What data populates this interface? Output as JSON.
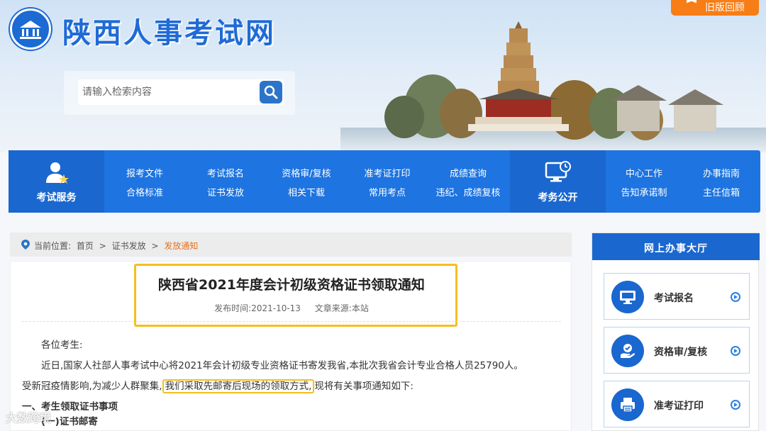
{
  "header": {
    "site_title": "陕西人事考试网",
    "old_version_label": "旧版回顾",
    "search": {
      "placeholder": "请输入检索内容"
    }
  },
  "nav": {
    "main_left": "考试服务",
    "main_right": "考务公开",
    "columns": [
      {
        "top": "报考文件",
        "bottom": "合格标准"
      },
      {
        "top": "考试报名",
        "bottom": "证书发放"
      },
      {
        "top": "资格审/复核",
        "bottom": "相关下载"
      },
      {
        "top": "准考证打印",
        "bottom": "常用考点"
      },
      {
        "top": "成绩查询",
        "bottom": "违纪、成绩复核"
      },
      {
        "top": "中心工作",
        "bottom": "告知承诺制"
      },
      {
        "top": "办事指南",
        "bottom": "主任信箱"
      }
    ]
  },
  "breadcrumb": {
    "prefix": "当前位置:",
    "items": [
      "首页",
      ">",
      "证书发放",
      ">"
    ],
    "current": "发放通知"
  },
  "article": {
    "title": "陕西省2021年度会计初级资格证书领取通知",
    "publish_time": "发布时间:2021-10-13",
    "source": "文章来源:本站",
    "greeting": "各位考生:",
    "para1": "近日,国家人社部人事考试中心将2021年会计初级专业资格证书寄发我省,本批次我省会计专业合格人员25790人。",
    "para2_start": "受新冠疫情影响,为减少人群聚集,",
    "para2_highlight": "我们采取先邮寄后现场的领取方式,",
    "para2_end": "现将有关事项通知如下:",
    "section1": "一、考生领取证书事项",
    "section1_sub": "(一)证书邮寄"
  },
  "sidebar": {
    "title": "网上办事大厅",
    "items": [
      {
        "label": "考试报名",
        "icon": "monitor-icon"
      },
      {
        "label": "资格审/复核",
        "icon": "hand-check-icon"
      },
      {
        "label": "准考证打印",
        "icon": "printer-icon"
      }
    ]
  },
  "watermark": "大数跨境",
  "colors": {
    "primary": "#1e74e0",
    "accent": "#f77d16",
    "highlight": "#f6be1e"
  }
}
